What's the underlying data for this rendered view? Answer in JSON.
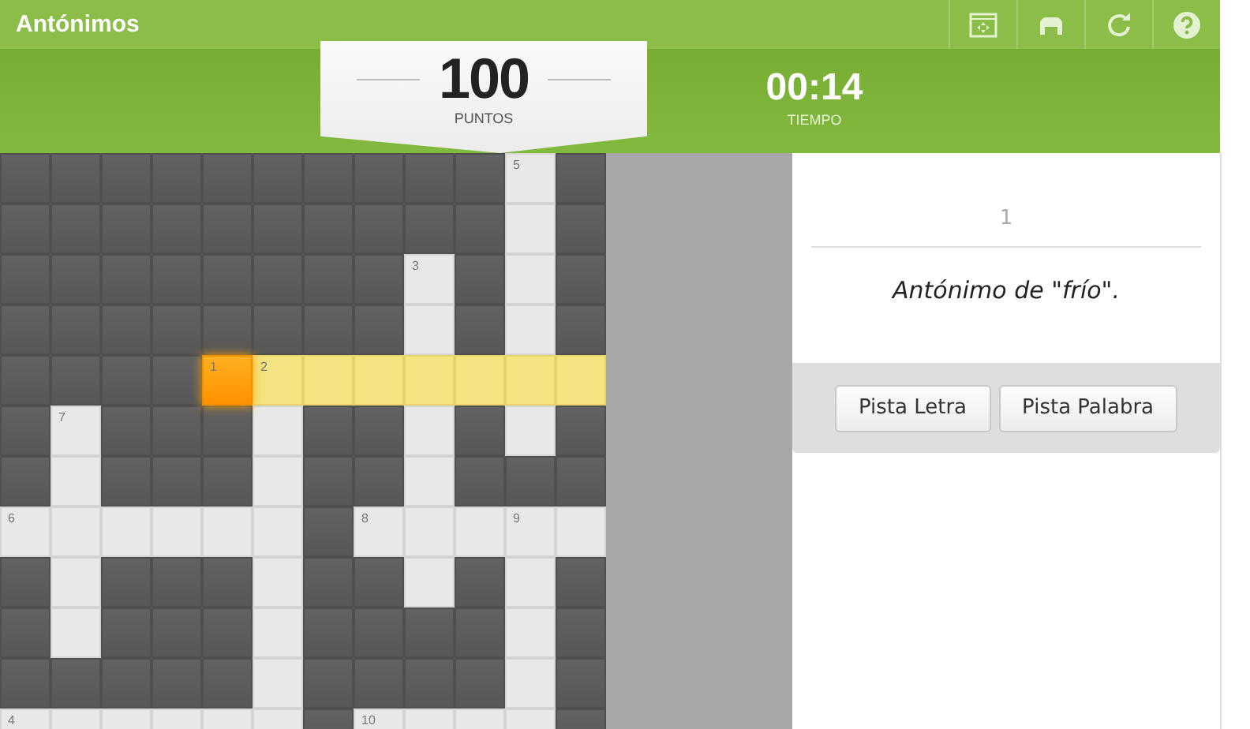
{
  "window": {
    "title": "Antónimos"
  },
  "toolbar": [
    {
      "kind": "fullscreen"
    },
    {
      "kind": "print"
    },
    {
      "kind": "restart"
    },
    {
      "kind": "help"
    }
  ],
  "score": {
    "value": "100",
    "label": "PUNTOS"
  },
  "timer": {
    "value": "00:14",
    "label": "TIEMPO"
  },
  "grid": [
    [
      {
        "kind": "block"
      },
      {
        "kind": "block"
      },
      {
        "kind": "block"
      },
      {
        "kind": "block"
      },
      {
        "kind": "block"
      },
      {
        "kind": "block"
      },
      {
        "kind": "block"
      },
      {
        "kind": "block"
      },
      {
        "kind": "block"
      },
      {
        "kind": "block"
      },
      {
        "kind": "open",
        "number": "5"
      },
      {
        "kind": "block"
      }
    ],
    [
      {
        "kind": "block"
      },
      {
        "kind": "block"
      },
      {
        "kind": "block"
      },
      {
        "kind": "block"
      },
      {
        "kind": "block"
      },
      {
        "kind": "block"
      },
      {
        "kind": "block"
      },
      {
        "kind": "block"
      },
      {
        "kind": "block"
      },
      {
        "kind": "block"
      },
      {
        "kind": "open"
      },
      {
        "kind": "block"
      }
    ],
    [
      {
        "kind": "block"
      },
      {
        "kind": "block"
      },
      {
        "kind": "block"
      },
      {
        "kind": "block"
      },
      {
        "kind": "block"
      },
      {
        "kind": "block"
      },
      {
        "kind": "block"
      },
      {
        "kind": "block"
      },
      {
        "kind": "open",
        "number": "3"
      },
      {
        "kind": "block"
      },
      {
        "kind": "open"
      },
      {
        "kind": "block"
      }
    ],
    [
      {
        "kind": "block"
      },
      {
        "kind": "block"
      },
      {
        "kind": "block"
      },
      {
        "kind": "block"
      },
      {
        "kind": "block"
      },
      {
        "kind": "block"
      },
      {
        "kind": "block"
      },
      {
        "kind": "block"
      },
      {
        "kind": "open"
      },
      {
        "kind": "block"
      },
      {
        "kind": "open"
      },
      {
        "kind": "block"
      }
    ],
    [
      {
        "kind": "block"
      },
      {
        "kind": "block"
      },
      {
        "kind": "block"
      },
      {
        "kind": "block"
      },
      {
        "kind": "active",
        "number": "1"
      },
      {
        "kind": "word",
        "number": "2"
      },
      {
        "kind": "word"
      },
      {
        "kind": "word"
      },
      {
        "kind": "word"
      },
      {
        "kind": "word"
      },
      {
        "kind": "word"
      },
      {
        "kind": "word"
      }
    ],
    [
      {
        "kind": "block"
      },
      {
        "kind": "open",
        "number": "7"
      },
      {
        "kind": "block"
      },
      {
        "kind": "block"
      },
      {
        "kind": "block"
      },
      {
        "kind": "open"
      },
      {
        "kind": "block"
      },
      {
        "kind": "block"
      },
      {
        "kind": "open"
      },
      {
        "kind": "block"
      },
      {
        "kind": "open"
      },
      {
        "kind": "block"
      }
    ],
    [
      {
        "kind": "block"
      },
      {
        "kind": "open"
      },
      {
        "kind": "block"
      },
      {
        "kind": "block"
      },
      {
        "kind": "block"
      },
      {
        "kind": "open"
      },
      {
        "kind": "block"
      },
      {
        "kind": "block"
      },
      {
        "kind": "open"
      },
      {
        "kind": "block"
      },
      {
        "kind": "block"
      },
      {
        "kind": "block"
      }
    ],
    [
      {
        "kind": "open",
        "number": "6"
      },
      {
        "kind": "open"
      },
      {
        "kind": "open"
      },
      {
        "kind": "open"
      },
      {
        "kind": "open"
      },
      {
        "kind": "open"
      },
      {
        "kind": "block"
      },
      {
        "kind": "open",
        "number": "8"
      },
      {
        "kind": "open"
      },
      {
        "kind": "open"
      },
      {
        "kind": "open",
        "number": "9"
      },
      {
        "kind": "open"
      }
    ],
    [
      {
        "kind": "block"
      },
      {
        "kind": "open"
      },
      {
        "kind": "block"
      },
      {
        "kind": "block"
      },
      {
        "kind": "block"
      },
      {
        "kind": "open"
      },
      {
        "kind": "block"
      },
      {
        "kind": "block"
      },
      {
        "kind": "open"
      },
      {
        "kind": "block"
      },
      {
        "kind": "open"
      },
      {
        "kind": "block"
      }
    ],
    [
      {
        "kind": "block"
      },
      {
        "kind": "open"
      },
      {
        "kind": "block"
      },
      {
        "kind": "block"
      },
      {
        "kind": "block"
      },
      {
        "kind": "open"
      },
      {
        "kind": "block"
      },
      {
        "kind": "block"
      },
      {
        "kind": "block"
      },
      {
        "kind": "block"
      },
      {
        "kind": "open"
      },
      {
        "kind": "block"
      }
    ],
    [
      {
        "kind": "block"
      },
      {
        "kind": "block"
      },
      {
        "kind": "block"
      },
      {
        "kind": "block"
      },
      {
        "kind": "block"
      },
      {
        "kind": "open"
      },
      {
        "kind": "block"
      },
      {
        "kind": "block"
      },
      {
        "kind": "block"
      },
      {
        "kind": "block"
      },
      {
        "kind": "open"
      },
      {
        "kind": "block"
      }
    ],
    [
      {
        "kind": "open",
        "number": "4"
      },
      {
        "kind": "open"
      },
      {
        "kind": "open"
      },
      {
        "kind": "open"
      },
      {
        "kind": "open"
      },
      {
        "kind": "open"
      },
      {
        "kind": "block"
      },
      {
        "kind": "open",
        "number": "10"
      },
      {
        "kind": "open"
      },
      {
        "kind": "open"
      },
      {
        "kind": "open"
      },
      {
        "kind": "block"
      }
    ]
  ],
  "clue": {
    "number": "1",
    "text": "Antónimo de \"frío\"."
  },
  "buttons": [
    "Pista Letra",
    "Pista Palabra"
  ]
}
